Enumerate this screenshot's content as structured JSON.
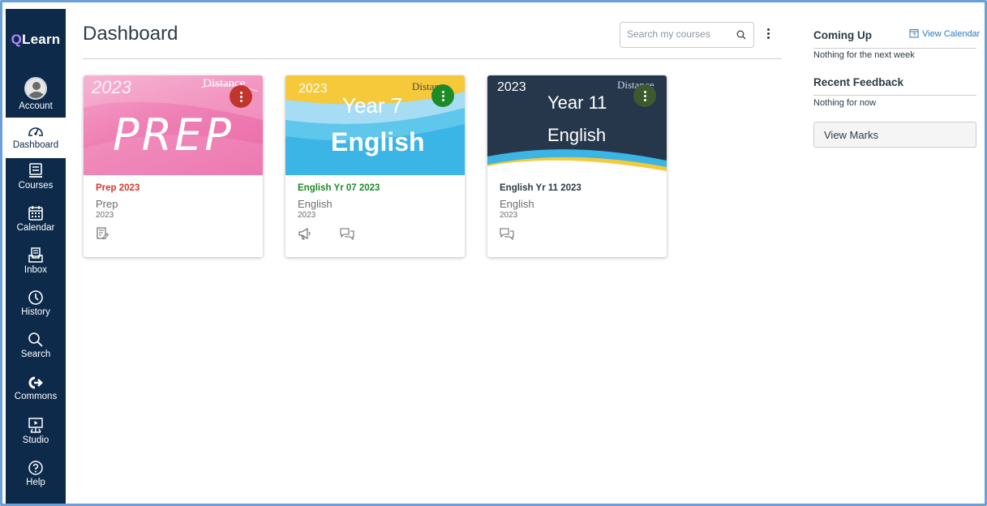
{
  "nav": {
    "logo_q": "Q",
    "logo_rest": "Learn",
    "items": [
      {
        "label": "Account",
        "icon": "avatar"
      },
      {
        "label": "Dashboard",
        "icon": "dashboard-icon"
      },
      {
        "label": "Courses",
        "icon": "courses-icon"
      },
      {
        "label": "Calendar",
        "icon": "calendar-icon"
      },
      {
        "label": "Inbox",
        "icon": "inbox-icon"
      },
      {
        "label": "History",
        "icon": "history-icon"
      },
      {
        "label": "Search",
        "icon": "search-icon"
      },
      {
        "label": "Commons",
        "icon": "commons-icon"
      },
      {
        "label": "Studio",
        "icon": "studio-icon"
      },
      {
        "label": "Help",
        "icon": "help-icon"
      }
    ],
    "active": "Dashboard"
  },
  "header": {
    "title": "Dashboard",
    "search_placeholder": "Search my courses"
  },
  "cards": [
    {
      "hero_year": "2023",
      "hero_main": "PREP",
      "hero_distance": "Distance",
      "code": "Prep 2023",
      "name": "Prep",
      "term": "2023",
      "code_color": "#d9382b",
      "menu_color": "#c0362c",
      "icons": [
        "assignments-icon"
      ]
    },
    {
      "hero_year": "2023",
      "hero_line1": "Year 7",
      "hero_line2": "English",
      "hero_distance": "Distance",
      "code": "English Yr 07 2023",
      "name": "English",
      "term": "2023",
      "code_color": "#1e8a27",
      "menu_color": "#1e8a27",
      "icons": [
        "announcements-icon",
        "discussions-icon"
      ]
    },
    {
      "hero_year": "2023",
      "hero_line1": "Year 11",
      "hero_line2": "English",
      "hero_distance": "Distance",
      "code": "English Yr 11 2023",
      "name": "English",
      "term": "2023",
      "code_color": "#2d3b45",
      "menu_color": "#3d5a2e",
      "icons": [
        "discussions-icon"
      ]
    }
  ],
  "sidebar": {
    "coming_up": "Coming Up",
    "view_calendar": "View Calendar",
    "coming_up_empty": "Nothing for the next week",
    "recent_feedback": "Recent Feedback",
    "feedback_empty": "Nothing for now",
    "view_marks": "View Marks"
  },
  "colors": {
    "nav_bg": "#0d2a4a",
    "link": "#2b7abc",
    "frame": "#6b9fd6"
  }
}
